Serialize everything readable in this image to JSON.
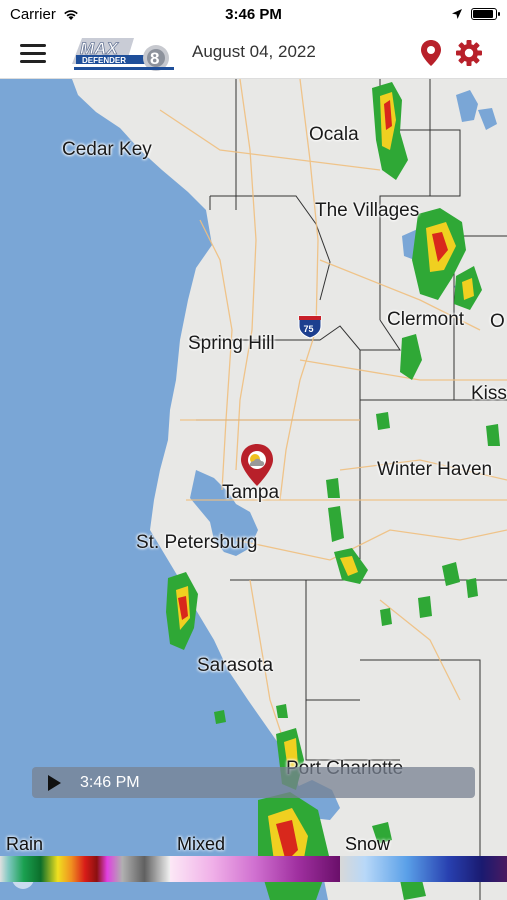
{
  "status_bar": {
    "carrier": "Carrier",
    "time": "3:46 PM"
  },
  "nav": {
    "date": "August 04, 2022",
    "logo_text_top": "MAX",
    "logo_text_bottom": "DEFENDER",
    "logo_number": "8"
  },
  "map": {
    "cities": [
      {
        "name": "Ocala"
      },
      {
        "name": "Cedar Key"
      },
      {
        "name": "The Villages"
      },
      {
        "name": "Clermont"
      },
      {
        "name": "O"
      },
      {
        "name": "Spring Hill"
      },
      {
        "name": "Kiss"
      },
      {
        "name": "Winter Haven"
      },
      {
        "name": "Tampa"
      },
      {
        "name": "St. Petersburg"
      },
      {
        "name": "Sarasota"
      },
      {
        "name": "Port Charlotte"
      }
    ],
    "highway_shield": "75"
  },
  "player": {
    "time": "3:46 PM"
  },
  "legend": {
    "rain": "Rain",
    "mixed": "Mixed",
    "snow": "Snow"
  },
  "colors": {
    "accent_red": "#b8202a",
    "water": "#7aa6d6",
    "land": "#e8e8e6"
  }
}
